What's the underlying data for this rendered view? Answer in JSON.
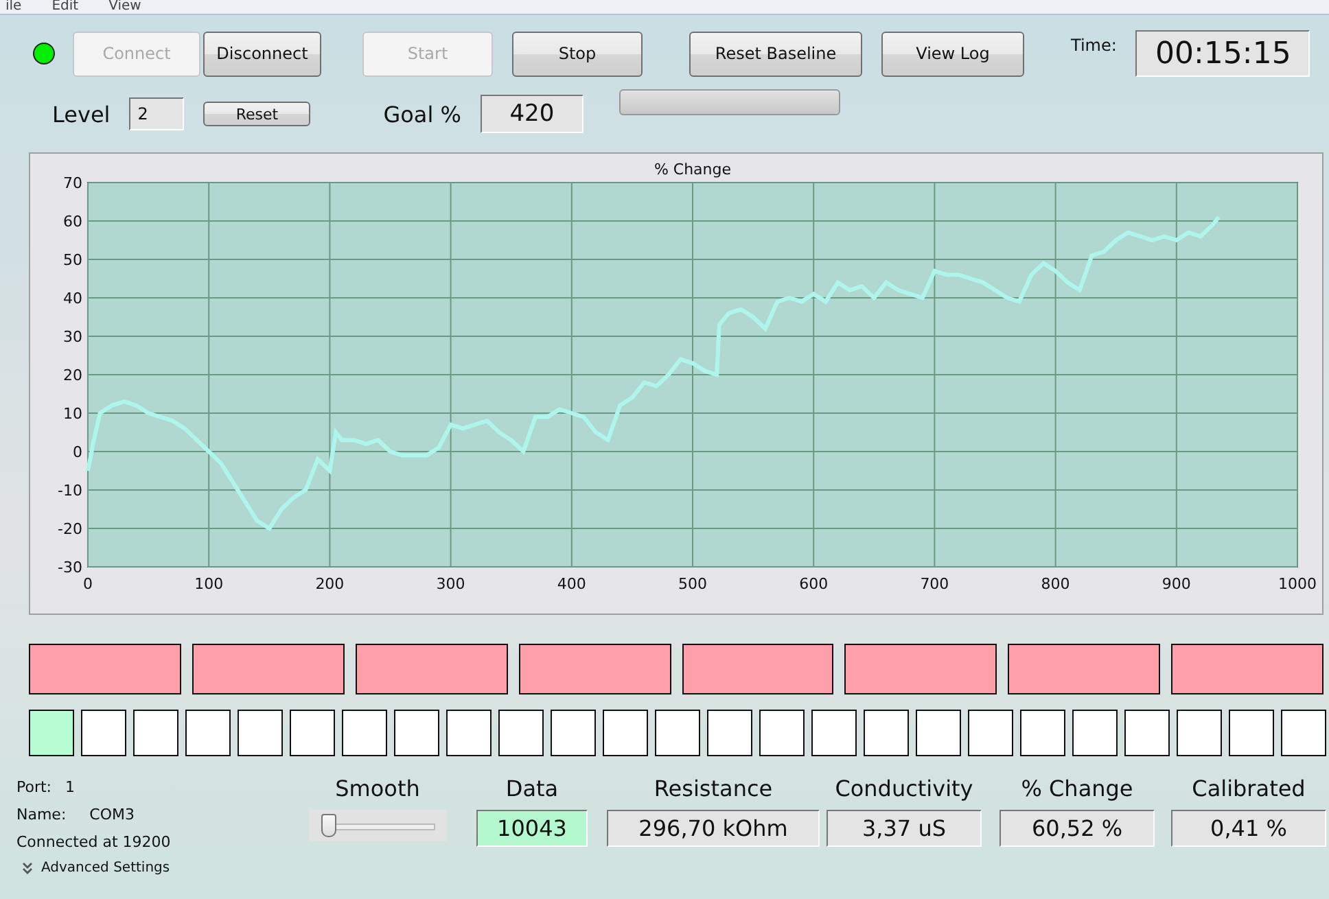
{
  "menu": [
    "ile",
    "Edit",
    "View"
  ],
  "status_led": {
    "on": true
  },
  "toolbar": [
    {
      "label": "Connect",
      "disabled": true
    },
    {
      "label": "Disconnect",
      "disabled": false
    },
    {
      "label": "Start",
      "disabled": true
    },
    {
      "label": "Stop",
      "disabled": false
    },
    {
      "label": "Reset Baseline",
      "disabled": false
    },
    {
      "label": "View Log",
      "disabled": false
    }
  ],
  "time": {
    "label": "Time:",
    "value": "00:15:15"
  },
  "level": {
    "label": "Level",
    "value": "2",
    "reset_button": "Reset"
  },
  "goal": {
    "label": "Goal %",
    "value": "420"
  },
  "goal_progress": {
    "level": 0
  },
  "chart": {
    "chart_data": {
      "type": "line",
      "title": "% Change",
      "xlim": [
        0,
        1000
      ],
      "ylim": [
        -30,
        70
      ],
      "xticks": [
        0,
        100,
        200,
        300,
        400,
        500,
        600,
        700,
        800,
        900,
        1000
      ],
      "yticks": [
        -30,
        -20,
        -10,
        0,
        10,
        20,
        30,
        40,
        50,
        60,
        70
      ],
      "grid": true,
      "x": [
        0,
        5,
        10,
        20,
        30,
        40,
        50,
        60,
        70,
        80,
        90,
        100,
        110,
        120,
        130,
        140,
        150,
        160,
        170,
        180,
        190,
        200,
        205,
        210,
        220,
        230,
        240,
        250,
        260,
        270,
        280,
        290,
        300,
        310,
        320,
        330,
        340,
        350,
        360,
        370,
        380,
        390,
        400,
        410,
        420,
        430,
        440,
        450,
        460,
        470,
        480,
        490,
        500,
        510,
        520,
        522,
        530,
        540,
        550,
        560,
        570,
        580,
        590,
        600,
        610,
        620,
        630,
        640,
        650,
        660,
        670,
        680,
        690,
        700,
        710,
        720,
        730,
        740,
        750,
        760,
        770,
        780,
        790,
        800,
        810,
        820,
        830,
        840,
        850,
        860,
        870,
        880,
        890,
        900,
        910,
        920,
        930,
        935
      ],
      "values": [
        -5,
        3,
        10,
        12,
        13,
        12,
        10,
        9,
        8,
        6,
        3,
        0,
        -3,
        -8,
        -13,
        -18,
        -20,
        -15,
        -12,
        -10,
        -2,
        -5,
        5,
        3,
        3,
        2,
        3,
        0,
        -1,
        -1,
        -1,
        1,
        7,
        6,
        7,
        8,
        5,
        3,
        0,
        9,
        9,
        11,
        10,
        9,
        5,
        3,
        12,
        14,
        18,
        17,
        20,
        24,
        23,
        21,
        20,
        33,
        36,
        37,
        35,
        32,
        39,
        40,
        39,
        41,
        39,
        44,
        42,
        43,
        40,
        44,
        42,
        41,
        40,
        47,
        46,
        46,
        45,
        44,
        42,
        40,
        39,
        46,
        49,
        47,
        44,
        42,
        51,
        52,
        55,
        57,
        56,
        55,
        56,
        55,
        57,
        56,
        59,
        61
      ]
    }
  },
  "goal_blocks": [
    {
      "on": false
    },
    {
      "on": false
    },
    {
      "on": false
    },
    {
      "on": false
    },
    {
      "on": false
    },
    {
      "on": false
    },
    {
      "on": false
    },
    {
      "on": false
    }
  ],
  "level_cells": [
    {
      "on": true
    },
    {
      "on": false
    },
    {
      "on": false
    },
    {
      "on": false
    },
    {
      "on": false
    },
    {
      "on": false
    },
    {
      "on": false
    },
    {
      "on": false
    },
    {
      "on": false
    },
    {
      "on": false
    },
    {
      "on": false
    },
    {
      "on": false
    },
    {
      "on": false
    },
    {
      "on": false
    },
    {
      "on": false
    },
    {
      "on": false
    },
    {
      "on": false
    },
    {
      "on": false
    },
    {
      "on": false
    },
    {
      "on": false
    },
    {
      "on": false
    },
    {
      "on": false
    },
    {
      "on": false
    },
    {
      "on": false
    },
    {
      "on": false
    }
  ],
  "port_info": {
    "port_label": "Port:",
    "port": "1",
    "name_label": "Name:",
    "name": "COM3",
    "status": "Connected at 19200",
    "advanced_settings": {
      "label": "Advanced Settings",
      "expanded": false
    }
  },
  "smooth": {
    "label": "Smooth",
    "level": 0.05
  },
  "readouts": [
    {
      "label": "Data",
      "value": "10043",
      "highlighted": true
    },
    {
      "label": "Resistance",
      "value": "296,70 kOhm",
      "highlighted": false
    },
    {
      "label": "Conductivity",
      "value": "3,37 uS",
      "highlighted": false
    },
    {
      "label": "% Change",
      "value": "60,52 %",
      "highlighted": false
    },
    {
      "label": "Calibrated",
      "value": "0,41 %",
      "highlighted": false
    }
  ]
}
